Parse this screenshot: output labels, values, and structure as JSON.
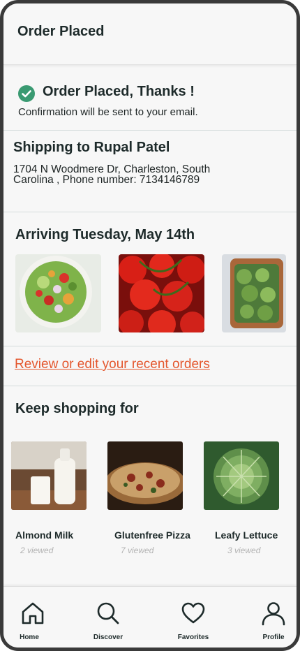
{
  "header": {
    "title": "Order Placed"
  },
  "confirmation": {
    "title": "Order Placed, Thanks !",
    "subtitle": "Confirmation will be  sent  to your email.",
    "icon": "check-circle-icon",
    "accent_color": "#3a9a72"
  },
  "shipping": {
    "title": "Shipping to  Rupal Patel",
    "address": "1704 N Woodmere Dr, Charleston, South Carolina , Phone number: 7134146789"
  },
  "arriving": {
    "title": "Arriving  Tuesday, May 14th",
    "items": [
      {
        "image": "salad-bowl-photo"
      },
      {
        "image": "tomatoes-photo"
      },
      {
        "image": "broccoli-photo"
      }
    ]
  },
  "review": {
    "link_text": "Review or edit your recent orders",
    "link_color": "#e4572e"
  },
  "keep_shopping": {
    "title": "Keep shopping for",
    "products": [
      {
        "name": "Almond Milk",
        "viewed": "2 viewed",
        "image": "almond-milk-photo"
      },
      {
        "name": "Glutenfree Pizza",
        "viewed": "7 viewed",
        "image": "pizza-photo"
      },
      {
        "name": "Leafy Lettuce",
        "viewed": "3 viewed",
        "image": "lettuce-photo"
      }
    ]
  },
  "tabbar": {
    "tabs": [
      {
        "label": "Home",
        "icon": "home-icon"
      },
      {
        "label": "Discover",
        "icon": "search-icon"
      },
      {
        "label": "Favorites",
        "icon": "heart-icon"
      },
      {
        "label": "Profile",
        "icon": "user-icon"
      }
    ]
  }
}
